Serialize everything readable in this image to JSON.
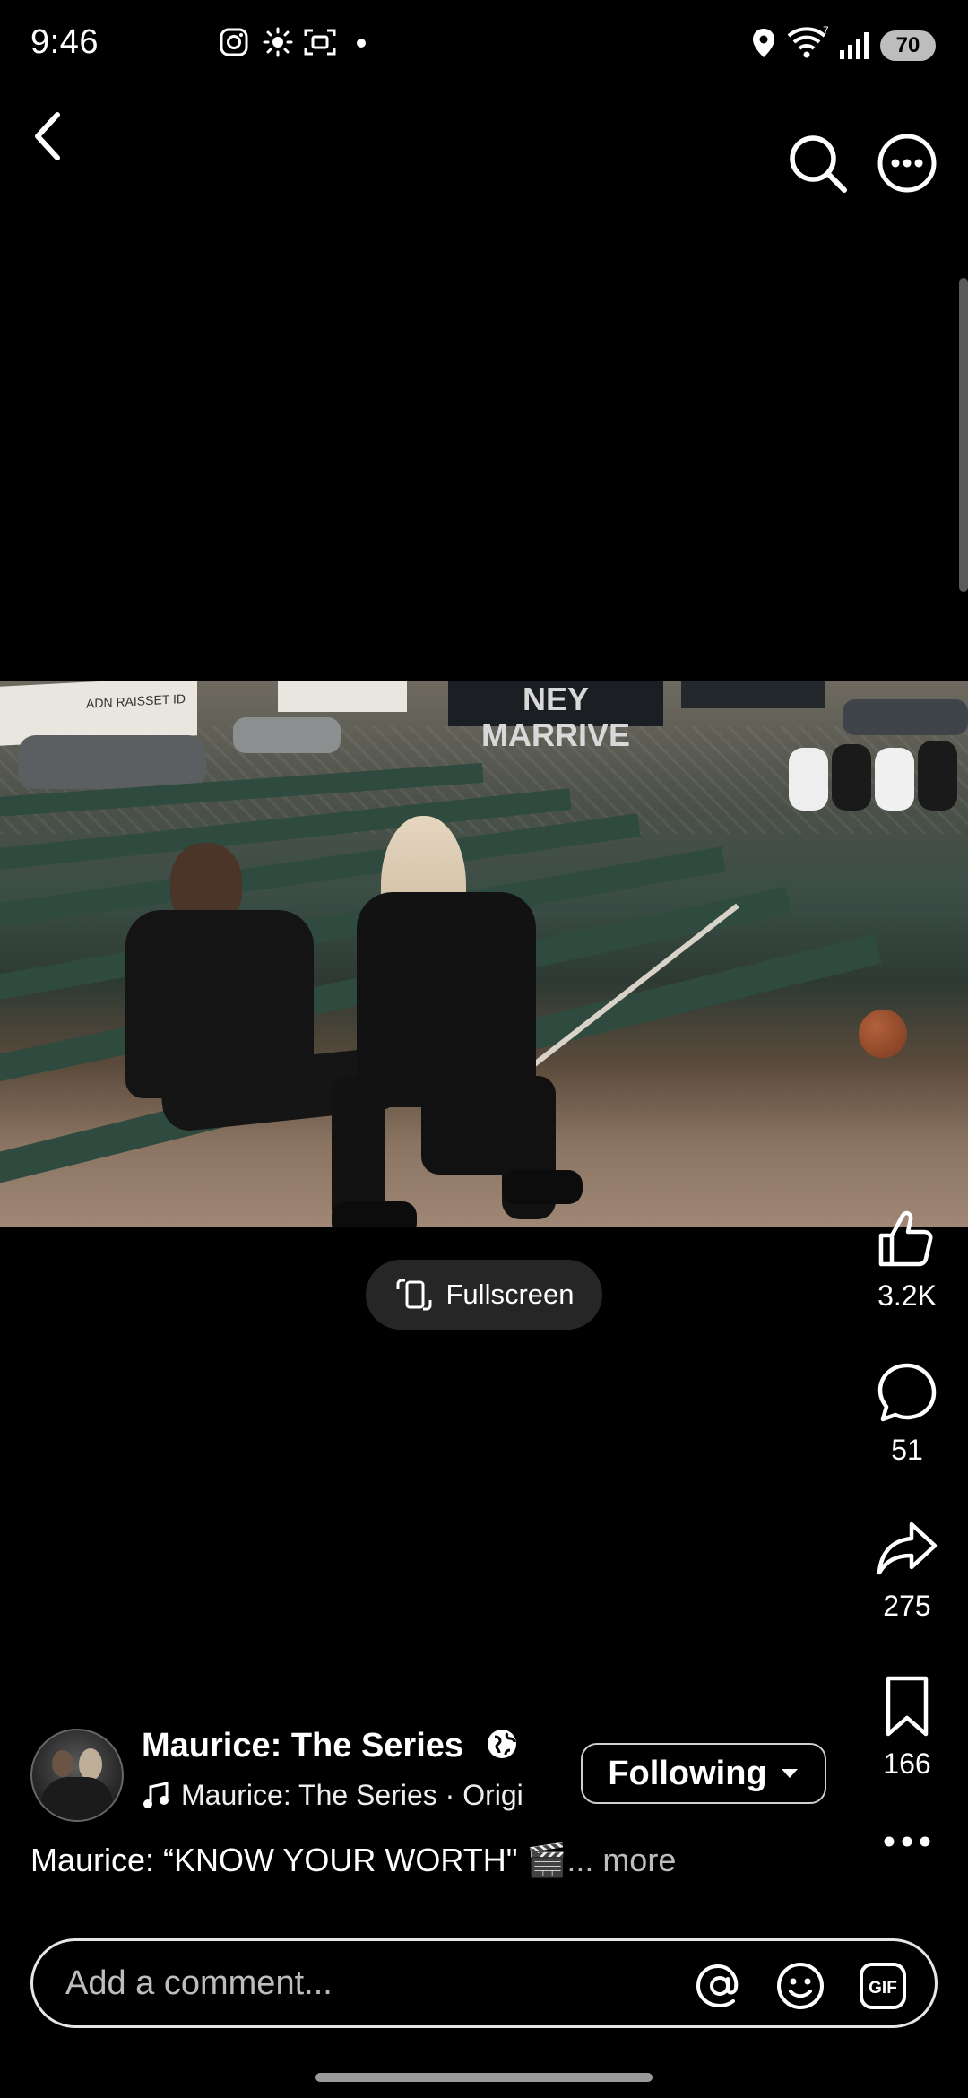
{
  "status_bar": {
    "time": "9:46",
    "battery": "70",
    "left_icons": [
      "instagram-icon",
      "brightness-icon",
      "screenshot-icon",
      "dot-icon"
    ],
    "right_icons": [
      "location-icon",
      "wifi-icon",
      "signal-icon",
      "battery-icon"
    ]
  },
  "header": {
    "back_icon": "back-icon",
    "search_icon": "search-icon",
    "more_icon": "more-icon"
  },
  "video": {
    "banner_center_text": "NEY MARRIVE",
    "banner_left_text": "ADN RAISSET ID"
  },
  "fullscreen": {
    "label": "Fullscreen"
  },
  "actions": {
    "likes": "3.2K",
    "comments": "51",
    "shares": "275",
    "saves": "166"
  },
  "post": {
    "account_name": "Maurice: The Series",
    "audio": "Maurice: The Series · Origi",
    "following_label": "Following",
    "caption": "Maurice: “KNOW YOUR WORTH\" 🎬",
    "more": "... more"
  },
  "comment": {
    "placeholder": "Add a comment..."
  },
  "colors": {
    "background": "#000000",
    "pill": "#262626",
    "bench_green": "#2f4a3e"
  }
}
